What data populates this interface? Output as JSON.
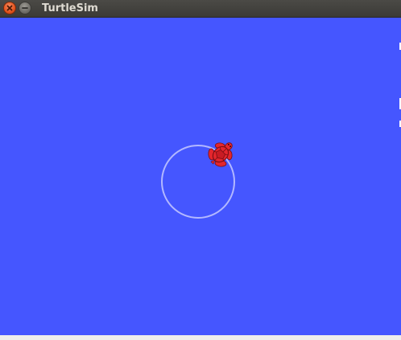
{
  "window": {
    "title": "TurtleSim",
    "close_icon": "close-icon",
    "minimize_icon": "minimize-icon"
  },
  "colors": {
    "background": "#4556ff",
    "pen": "#b3b8ff",
    "turtle": "#e3262d"
  },
  "canvas": {
    "turtle_heading_deg": 45
  }
}
